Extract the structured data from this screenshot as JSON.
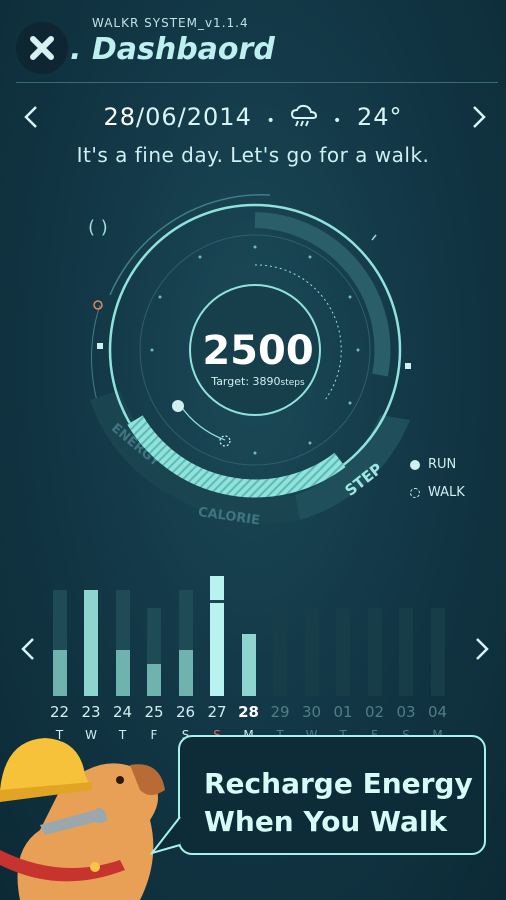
{
  "header": {
    "system_label": "WALKR SYSTEM_v1.1.4",
    "title": ". Dashbaord",
    "close_icon": "close-icon"
  },
  "date_row": {
    "day": "28",
    "rest": "/06/2014",
    "sep": "•",
    "weather_icon": "rain-cloud-icon",
    "temperature": "24°",
    "prev_icon": "chevron-left-icon",
    "next_icon": "chevron-right-icon"
  },
  "tagline": "It's a fine day.  Let's go for a walk.",
  "dial": {
    "steps": "2500",
    "target_label": "Target: 3890",
    "target_unit": "steps",
    "steps_value": 2500,
    "target_value": 3890,
    "labels": {
      "energy": "ENERGY",
      "calorie": "CALORIE",
      "step": "STEP"
    }
  },
  "legend": {
    "run": "RUN",
    "walk": "WALK"
  },
  "week": {
    "days": [
      {
        "date": "22",
        "weekday": "T",
        "run": 0.38,
        "walk": 0.88,
        "active": true
      },
      {
        "date": "23",
        "weekday": "W",
        "run": 0.88,
        "walk": 0.88,
        "active": true
      },
      {
        "date": "24",
        "weekday": "T",
        "run": 0.38,
        "walk": 0.88,
        "active": true
      },
      {
        "date": "25",
        "weekday": "F",
        "run": 0.27,
        "walk": 0.73,
        "active": true
      },
      {
        "date": "26",
        "weekday": "S",
        "run": 0.38,
        "walk": 0.88,
        "active": true
      },
      {
        "date": "27",
        "weekday": "S",
        "run": 1.0,
        "walk": 1.0,
        "active": true
      },
      {
        "date": "28",
        "weekday": "M",
        "run": 0.52,
        "walk": 0.52,
        "active": true,
        "today": true
      },
      {
        "date": "29",
        "weekday": "T",
        "run": 0,
        "walk": 0.73,
        "active": false
      },
      {
        "date": "30",
        "weekday": "W",
        "run": 0,
        "walk": 0.73,
        "active": false
      },
      {
        "date": "01",
        "weekday": "T",
        "run": 0,
        "walk": 0.73,
        "active": false
      },
      {
        "date": "02",
        "weekday": "F",
        "run": 0,
        "walk": 0.73,
        "active": false
      },
      {
        "date": "03",
        "weekday": "S",
        "run": 0,
        "walk": 0.73,
        "active": false
      },
      {
        "date": "04",
        "weekday": "M",
        "run": 0,
        "walk": 0.73,
        "active": false
      }
    ]
  },
  "promo": {
    "line1": "Recharge Energy",
    "line2": "When You Walk"
  },
  "colors": {
    "accent": "#8fe3dc",
    "bg": "#133847",
    "bar_dim": "#1f4b57",
    "sunday": "#e0704a"
  }
}
